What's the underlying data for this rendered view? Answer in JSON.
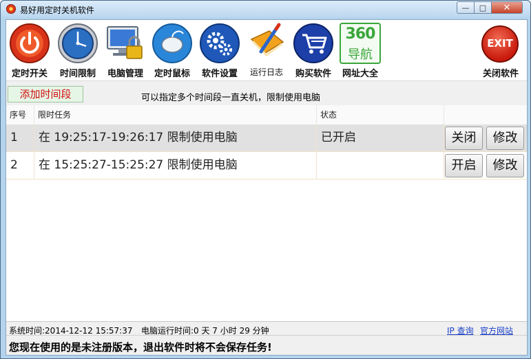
{
  "window": {
    "title": "易好用定时关机软件",
    "controls": {
      "minimize": "—",
      "maximize": "□",
      "close": "✕"
    }
  },
  "toolbar": {
    "items": [
      {
        "label": "定时开关",
        "icon": "power-icon"
      },
      {
        "label": "时间限制",
        "icon": "clock-icon"
      },
      {
        "label": "电脑管理",
        "icon": "monitor-lock-icon"
      },
      {
        "label": "定时鼠标",
        "icon": "mouse-icon"
      },
      {
        "label": "软件设置",
        "icon": "gears-icon"
      },
      {
        "label": "运行日志",
        "icon": "notebook-pen-icon"
      },
      {
        "label": "购买软件",
        "icon": "cart-icon"
      },
      {
        "label": "网址大全",
        "icon": "nav360-icon",
        "icon_text_top": "360",
        "icon_text_bottom": "导航"
      },
      {
        "label": "关闭软件",
        "icon": "exit-icon",
        "icon_text": "EXIT"
      }
    ]
  },
  "actions": {
    "add_label": "添加时间段",
    "hint": "可以指定多个时间段一直关机，限制使用电脑"
  },
  "table": {
    "columns": [
      "序号",
      "限时任务",
      "状态"
    ],
    "rows": [
      {
        "index": "1",
        "task": "在 19:25:17-19:26:17 限制使用电脑",
        "status": "已开启",
        "toggle_label": "关闭",
        "edit_label": "修改",
        "selected": true
      },
      {
        "index": "2",
        "task": "在 15:25:27-15:25:27 限制使用电脑",
        "status": "",
        "toggle_label": "开启",
        "edit_label": "修改",
        "selected": false
      }
    ]
  },
  "status": {
    "system_time": "系统时间:2014-12-12 15:57:37",
    "run_time": "电脑运行时间:0 天 7 小时 29 分钟",
    "ip_link": "IP 查询",
    "site_link": "官方网站"
  },
  "warning": "您现在使用的是未注册版本，退出软件时将不会保存任务!",
  "colors": {
    "accent_red": "#d01010",
    "link_blue": "#1a3fc7",
    "add_bg": "#e6f6e6"
  }
}
